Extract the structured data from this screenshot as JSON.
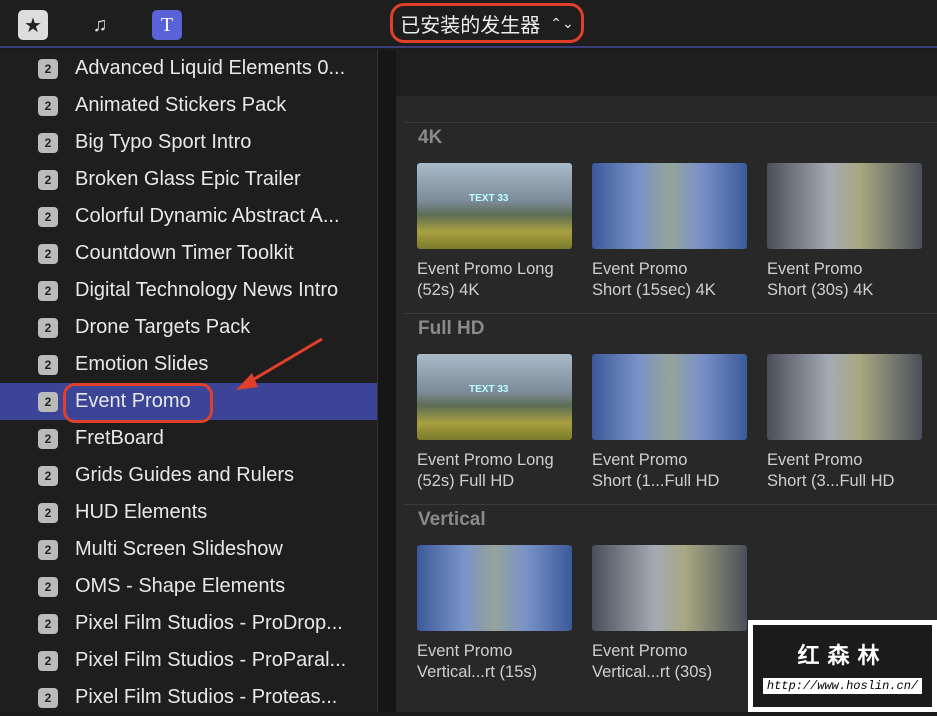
{
  "toolbar": {
    "selector_label": "已安装的发生器",
    "icons": [
      "clapper-star-icon",
      "photo-music-icon",
      "titles-generators-icon"
    ]
  },
  "sidebar": {
    "items": [
      {
        "label": "Advanced Liquid Elements 0..."
      },
      {
        "label": "Animated Stickers Pack"
      },
      {
        "label": "Big Typo Sport Intro"
      },
      {
        "label": "Broken Glass Epic Trailer"
      },
      {
        "label": "Colorful Dynamic Abstract A..."
      },
      {
        "label": "Countdown Timer Toolkit"
      },
      {
        "label": "Digital Technology News Intro"
      },
      {
        "label": "Drone Targets Pack"
      },
      {
        "label": "Emotion Slides"
      },
      {
        "label": "Event Promo"
      },
      {
        "label": "FretBoard"
      },
      {
        "label": "Grids Guides and Rulers"
      },
      {
        "label": "HUD Elements"
      },
      {
        "label": "Multi Screen Slideshow"
      },
      {
        "label": "OMS - Shape Elements"
      },
      {
        "label": "Pixel Film Studios - ProDrop..."
      },
      {
        "label": "Pixel Film Studios - ProParal..."
      },
      {
        "label": "Pixel Film Studios - Proteas..."
      }
    ],
    "selected_index": 9,
    "badge": "2"
  },
  "sections": [
    {
      "title": "4K",
      "clips": [
        {
          "l1": "Event Promo Long",
          "l2": "(52s) 4K",
          "thumb_text": "TEXT 33"
        },
        {
          "l1": "Event Promo",
          "l2": "Short (15sec) 4K"
        },
        {
          "l1": "Event Promo",
          "l2": "Short (30s) 4K"
        }
      ]
    },
    {
      "title": "Full HD",
      "clips": [
        {
          "l1": "Event Promo Long",
          "l2": "(52s) Full HD",
          "thumb_text": "TEXT 33"
        },
        {
          "l1": "Event Promo",
          "l2": "Short (1...Full HD"
        },
        {
          "l1": "Event Promo",
          "l2": "Short (3...Full HD"
        }
      ]
    },
    {
      "title": "Vertical",
      "clips": [
        {
          "l1": "Event Promo",
          "l2": "Vertical...rt (15s)"
        },
        {
          "l1": "Event Promo",
          "l2": "Vertical...rt (30s)"
        }
      ]
    }
  ],
  "watermark": {
    "title": "红森林",
    "url": "http://www.hoslin.cn/"
  }
}
